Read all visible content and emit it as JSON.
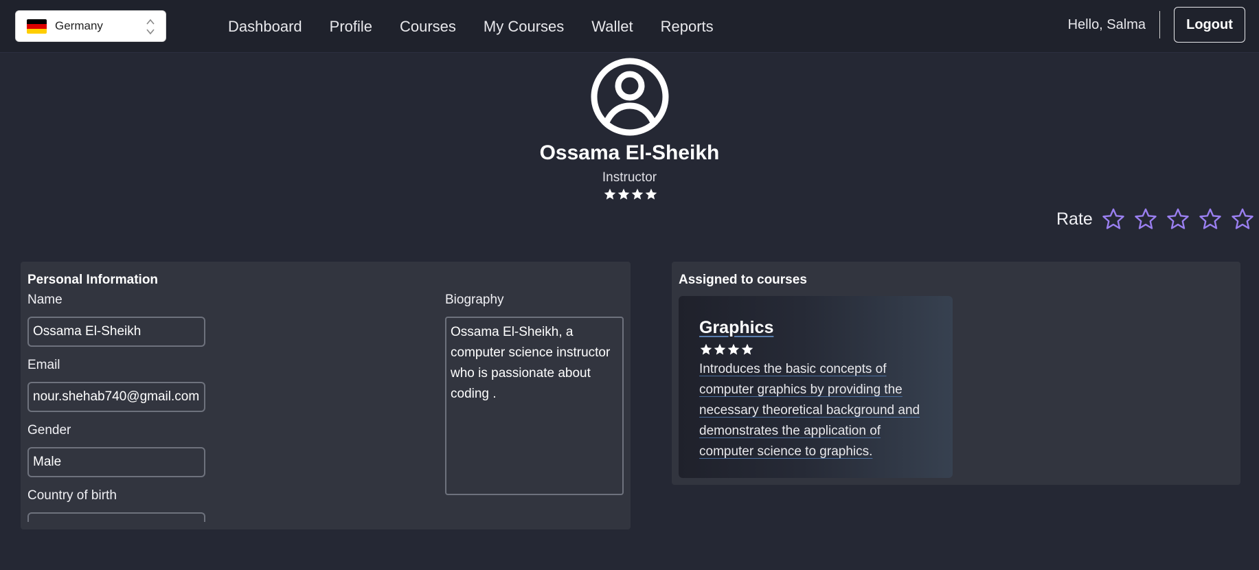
{
  "navbar": {
    "country": "Germany",
    "links": [
      "Dashboard",
      "Profile",
      "Courses",
      "My Courses",
      "Wallet",
      "Reports"
    ],
    "greeting": "Hello, Salma",
    "logout_label": "Logout"
  },
  "profile": {
    "name": "Ossama El-Sheikh",
    "role": "Instructor",
    "rating_stars": 4
  },
  "rate": {
    "label": "Rate",
    "star_count": 5,
    "star_color": "#9a7ff0"
  },
  "personal_info": {
    "title": "Personal Information",
    "name_label": "Name",
    "name_value": "Ossama El-Sheikh",
    "email_label": "Email",
    "email_value": "nour.shehab740@gmail.com",
    "gender_label": "Gender",
    "gender_value": "Male",
    "country_label": "Country of birth",
    "country_value": "",
    "bio_label": "Biography",
    "bio_value": "Ossama El-Sheikh, a computer science instructor who is passionate about coding ."
  },
  "courses": {
    "title": "Assigned to courses",
    "items": [
      {
        "title": "Graphics",
        "rating_stars": 4,
        "description": "Introduces the basic concepts of computer graphics by providing the necessary theoretical background and demonstrates the application of computer science to graphics."
      }
    ]
  },
  "colors": {
    "background": "#252834",
    "navbar": "#1f222c",
    "panel": "#32353f",
    "flag": [
      "#000000",
      "#dd0000",
      "#ffce00"
    ]
  }
}
